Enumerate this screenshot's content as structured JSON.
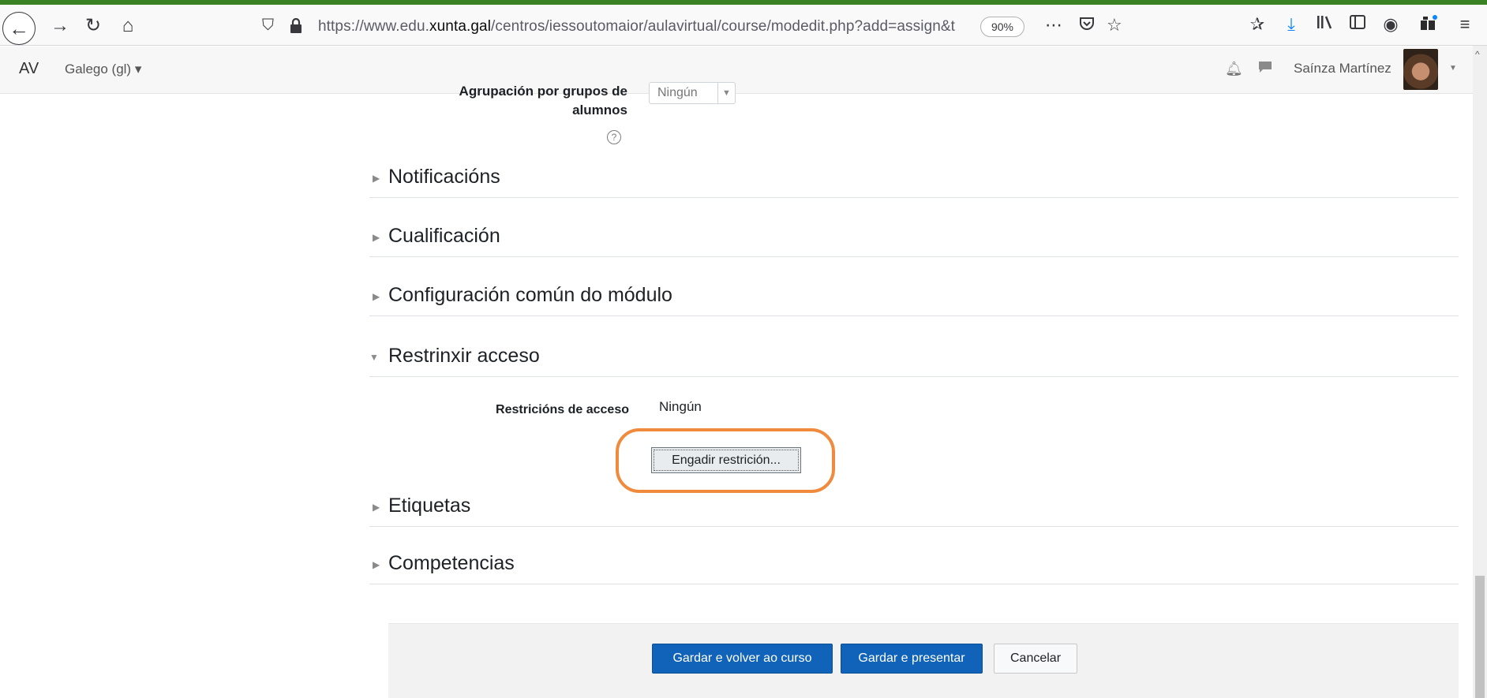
{
  "browser": {
    "url_prefix": "https://www.edu.",
    "url_domain": "xunta.gal",
    "url_path": "/centros/iessoutomaior/aulavirtual/course/modedit.php?add=assign&t",
    "zoom": "90%"
  },
  "navbar": {
    "brand": "AV",
    "language": "Galego (gl) ▾",
    "user_name": "Saínza Martínez"
  },
  "form": {
    "group_label": "Agrupación por grupos de alumnos",
    "group_value": "Ningún",
    "sections": [
      {
        "title": "Notificacións"
      },
      {
        "title": "Cualificación"
      },
      {
        "title": "Configuración común do módulo"
      },
      {
        "title": "Restrinxir acceso"
      },
      {
        "title": "Etiquetas"
      },
      {
        "title": "Competencias"
      }
    ],
    "access_restrictions_label": "Restricións de acceso",
    "access_restrictions_value": "Ningún",
    "add_restriction_button": "Engadir restrición..."
  },
  "footer": {
    "save_return": "Gardar e volver ao curso",
    "save_display": "Gardar e presentar",
    "cancel": "Cancelar"
  },
  "icons": {
    "back": "back-arrow-icon",
    "forward": "forward-arrow-icon",
    "reload": "reload-icon",
    "home": "home-icon",
    "shield": "tracking-shield-icon",
    "lock": "lock-icon",
    "page_actions": "more-dots-icon",
    "pocket": "pocket-icon",
    "bookmark": "bookmark-star-icon",
    "highlight_color": "#f08a3c"
  }
}
